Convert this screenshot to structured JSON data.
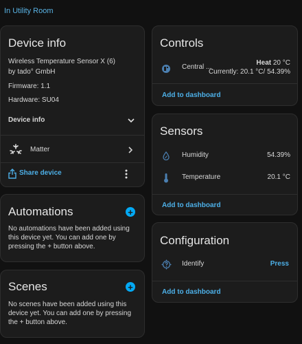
{
  "breadcrumb": "In Utility Room",
  "device_info": {
    "title": "Device info",
    "model": "Wireless Temperature Sensor X (6)",
    "manufacturer": "by tado° GmbH",
    "firmware": "Firmware: 1.1",
    "hardware": "Hardware: SU04",
    "section_label": "Device info",
    "matter_label": "Matter",
    "share_label": "Share device"
  },
  "automations": {
    "title": "Automations",
    "empty_text": "No automations have been added using this device yet. You can add one by pressing the + button above."
  },
  "scenes": {
    "title": "Scenes",
    "empty_text": "No scenes have been added using this device yet. You can add one by pressing the + button above."
  },
  "controls": {
    "title": "Controls",
    "entity_name": "Central ...",
    "state_mode": "Heat",
    "state_temp": "20 °C",
    "state_current": "Currently: 20.1 °C/ 54.39%",
    "add_label": "Add to dashboard"
  },
  "sensors": {
    "title": "Sensors",
    "items": [
      {
        "label": "Humidity",
        "value": "54.39%",
        "icon": "water-percent-icon"
      },
      {
        "label": "Temperature",
        "value": "20.1 °C",
        "icon": "thermometer-icon"
      }
    ],
    "add_label": "Add to dashboard"
  },
  "configuration": {
    "title": "Configuration",
    "identify_label": "Identify",
    "press_label": "Press",
    "add_label": "Add to dashboard"
  },
  "colors": {
    "accent": "#03a9f4",
    "link": "#4db0e8",
    "card_bg": "#1c1c1c",
    "page_bg": "#111111"
  }
}
